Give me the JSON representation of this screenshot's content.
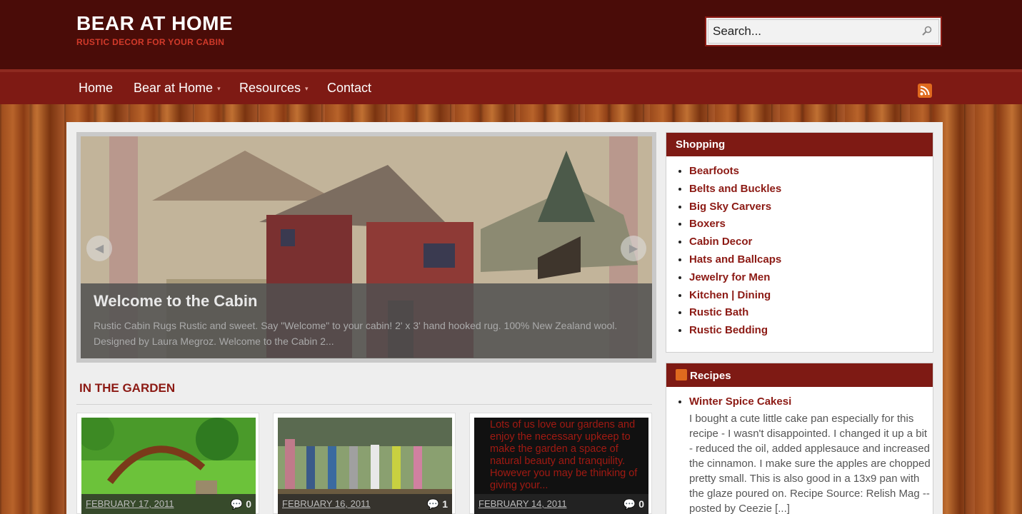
{
  "site": {
    "title": "BEAR AT HOME",
    "tagline": "RUSTIC DECOR FOR YOUR CABIN"
  },
  "search": {
    "placeholder": "Search..."
  },
  "nav": {
    "items": [
      {
        "label": "Home"
      },
      {
        "label": "Bear at Home"
      },
      {
        "label": "Resources"
      },
      {
        "label": "Contact"
      }
    ],
    "dropdown_glyph": "▾"
  },
  "slider": {
    "title": "Welcome to the Cabin",
    "text": "Rustic Cabin Rugs Rustic and sweet. Say \"Welcome\" to your cabin! 2' x 3' hand hooked rug. 100% New Zealand wool. Designed by Laura Megroz. Welcome to the Cabin 2...",
    "prev": "◀",
    "next": "▶"
  },
  "garden": {
    "title": "IN THE GARDEN",
    "posts": [
      {
        "date": "FEBRUARY 17, 2011",
        "comments": "0"
      },
      {
        "date": "FEBRUARY 16, 2011",
        "comments": "1"
      },
      {
        "date": "FEBRUARY 14, 2011",
        "comments": "0",
        "alt": "Lots of us love our gardens and enjoy the necessary upkeep to make the garden a space of natural beauty and tranquility. However you may be thinking of giving your..."
      }
    ]
  },
  "shopping": {
    "title": "Shopping",
    "items": [
      "Bearfoots",
      "Belts and Buckles",
      "Big Sky Carvers",
      "Boxers",
      "Cabin Decor",
      "Hats and Ballcaps",
      "Jewelry for Men",
      "Kitchen | Dining",
      "Rustic Bath",
      "Rustic Bedding"
    ]
  },
  "recipes": {
    "title": "Recipes",
    "item_title": "Winter Spice Cakesi",
    "item_text": "I bought a cute little cake pan especially for this recipe - I wasn't disappointed. I changed it up a bit - reduced the oil, added applesauce and increased the cinnamon. I make sure the apples are chopped pretty small. This is also good in a 13x9 pan with the glaze poured on. Recipe Source: Relish Mag -- posted by Ceezie [...]"
  },
  "colors": {
    "brand_dark": "#4a0c08",
    "accent": "#7e1a14",
    "link": "#8c1a14"
  }
}
